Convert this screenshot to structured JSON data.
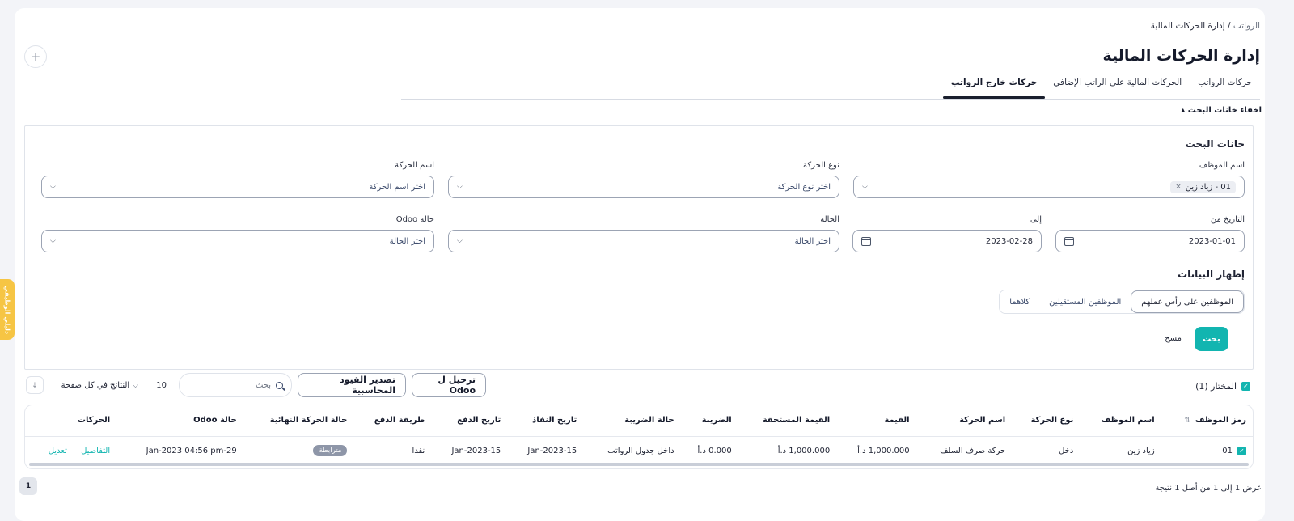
{
  "breadcrumb": {
    "first": "الرواتب",
    "separator": " / ",
    "current": "إدارة الحركات المالية"
  },
  "page_title": "إدارة الحركات المالية",
  "add_button": "+",
  "tabs": [
    {
      "label": "حركات الرواتب",
      "active": false
    },
    {
      "label": "الحركات المالية على الراتب الإضافي",
      "active": false
    },
    {
      "label": "حركات خارج الرواتب",
      "active": true
    }
  ],
  "toggle_search_label": "اخفاء خانات البحث ▴",
  "search": {
    "title": "خانات البحث",
    "employee_label": "اسم الموظف",
    "employee_chip": "01 - زياد زين",
    "type_label": "نوع الحركة",
    "type_placeholder": "اختر نوع الحركة",
    "name_label": "اسم الحركة",
    "name_placeholder": "اختر اسم الحركة",
    "date_from_label": "التاريخ من",
    "date_from_value": "2023-01-01",
    "date_to_label": "إلى",
    "date_to_value": "2023-02-28",
    "status_label": "الحالة",
    "status_placeholder": "اختر الحالة",
    "odoo_label": "حالة Odoo",
    "odoo_placeholder": "اختر الحالة",
    "display_title": "إظهار البيانات",
    "display_options": [
      "الموظفين على رأس عملهم",
      "الموظفين المستقيلين",
      "كلاهما"
    ],
    "search_button": "بحث",
    "clear_button": "مسح"
  },
  "toolbar": {
    "selected_label": "المختار (1)",
    "post_odoo": "ترحيل ل Odoo",
    "export_entries": "تصدير القيود المحاسبية",
    "search_placeholder": "بحث",
    "page_size": "10",
    "page_size_label": "النتائج في كل صفحة"
  },
  "table": {
    "headers": [
      "رمز الموظف",
      "اسم الموظف",
      "نوع الحركة",
      "اسم الحركة",
      "القيمة",
      "القيمة المستحقة",
      "الضريبة",
      "حالة الضريبة",
      "تاريخ النفاذ",
      "تاريخ الدفع",
      "طريقة الدفع",
      "حالة الحركة النهائية",
      "حالة Odoo",
      "الحركات"
    ],
    "row": {
      "code": "01",
      "employee": "زياد زين",
      "type": "دخل",
      "name": "حركة صرف السلف",
      "value": "1,000.000 د.أ",
      "due": "1,000.000 د.أ",
      "tax": "0.000 د.أ",
      "tax_status": "داخل جدول الرواتب",
      "effective_date": "15-Jan-2023",
      "pay_date": "15-Jan-2023",
      "pay_method": "نقدا",
      "final_status": "مترابطة",
      "odoo_status": "29-Jan-2023 04:56 pm",
      "details": "التفاصيل",
      "edit": "تعديل"
    }
  },
  "pagination": {
    "page": "1",
    "info": "عرض 1 إلى 1 من أصل 1 نتيجة"
  },
  "side_tab": "دليلي الوظيفي",
  "colors": {
    "accent": "#12b5b0",
    "side_tab": "#f6c544",
    "badge": "#8e96a8"
  }
}
